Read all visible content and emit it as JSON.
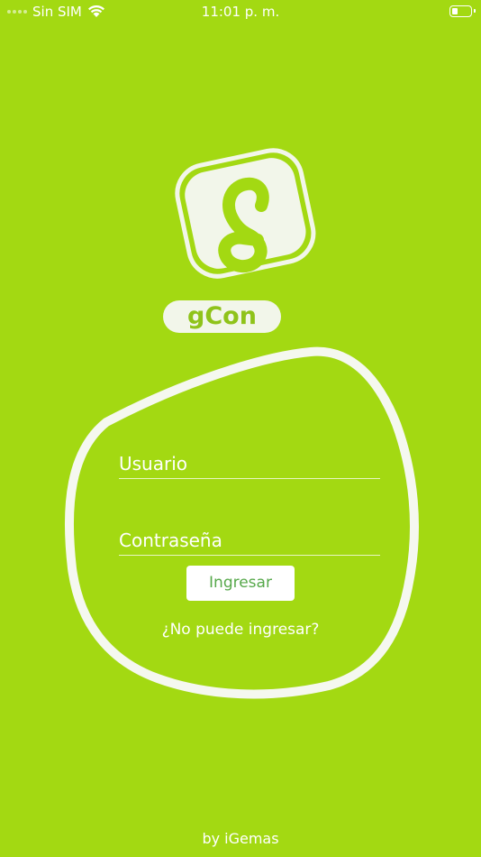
{
  "status_bar": {
    "carrier": "Sin SIM",
    "time": "11:01 p. m.",
    "battery_level": 0.35,
    "icons": [
      "signal-dots-icon",
      "wifi-icon",
      "battery-icon"
    ]
  },
  "logo": {
    "wordmark": "gCon",
    "icon": "gcon-logo-icon"
  },
  "login": {
    "username_placeholder": "Usuario",
    "password_placeholder": "Contraseña",
    "submit_label": "Ingresar",
    "forgot_label": "¿No puede ingresar?"
  },
  "footer": {
    "credit": "by iGemas"
  },
  "colors": {
    "background": "#a3d912",
    "button_text": "#56a84a",
    "white": "#ffffff"
  }
}
